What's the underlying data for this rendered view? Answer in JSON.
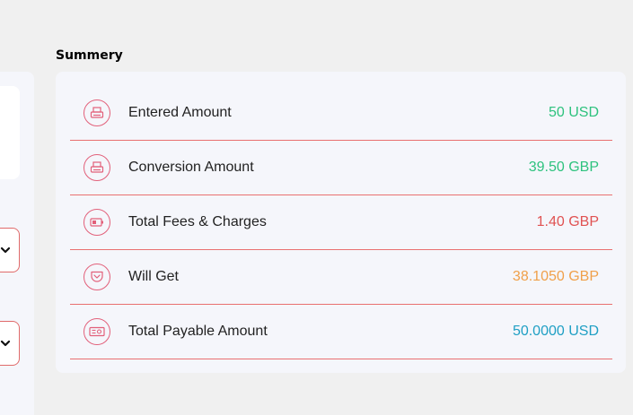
{
  "summary": {
    "title": "Summery",
    "rows": [
      {
        "icon": "printer-icon",
        "label": "Entered Amount",
        "value": "50 USD",
        "color": "#2ec27e"
      },
      {
        "icon": "printer-icon",
        "label": "Conversion Amount",
        "value": "39.50 GBP",
        "color": "#2ec27e"
      },
      {
        "icon": "battery-icon",
        "label": "Total Fees & Charges",
        "value": "1.40 GBP",
        "color": "#e05252"
      },
      {
        "icon": "pocket-icon",
        "label": "Will Get",
        "value": "38.1050 GBP",
        "color": "#f0a04a"
      },
      {
        "icon": "cash-icon",
        "label": "Total Payable Amount",
        "value": "50.0000 USD",
        "color": "#1f9fc4"
      }
    ]
  }
}
